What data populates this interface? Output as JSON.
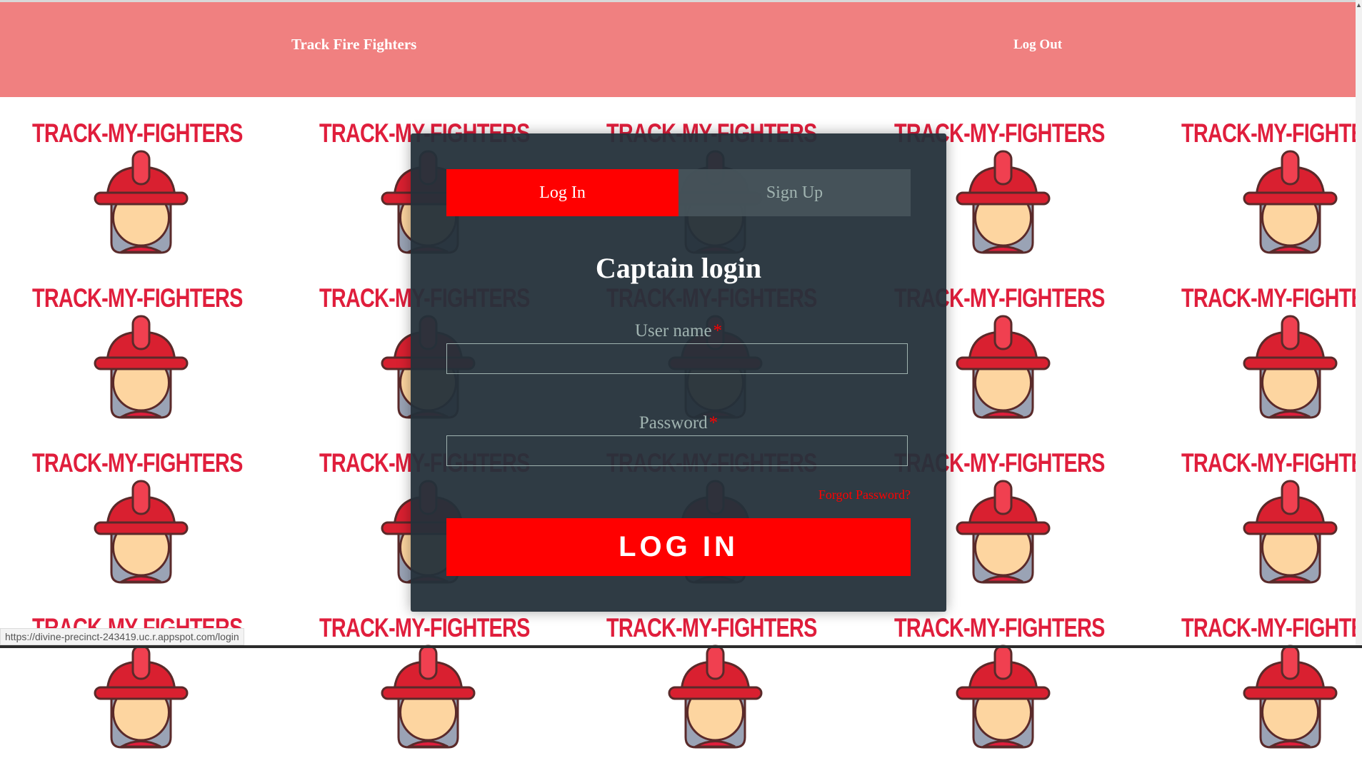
{
  "navbar": {
    "brand": "Track Fire Fighters",
    "logout_label": "Log Out",
    "background_color": "#f08080"
  },
  "background": {
    "pattern_text": "TRACK-MY-FIGHTERS",
    "icon": "firefighter-icon",
    "text_color": "#e01e3c"
  },
  "login_panel": {
    "tabs": [
      {
        "label": "Log In",
        "active": true
      },
      {
        "label": "Sign Up",
        "active": false
      }
    ],
    "title": "Captain login",
    "fields": {
      "username": {
        "label": "User name",
        "required_marker": "*",
        "value": "",
        "placeholder": ""
      },
      "password": {
        "label": "Password",
        "required_marker": "*",
        "value": "",
        "placeholder": ""
      }
    },
    "forgot_password": "Forgot Password?",
    "submit_label": "LOG IN",
    "accent_color": "#ff0000"
  },
  "status_bar": {
    "url": "https://divine-precinct-243419.uc.r.appspot.com/login"
  }
}
